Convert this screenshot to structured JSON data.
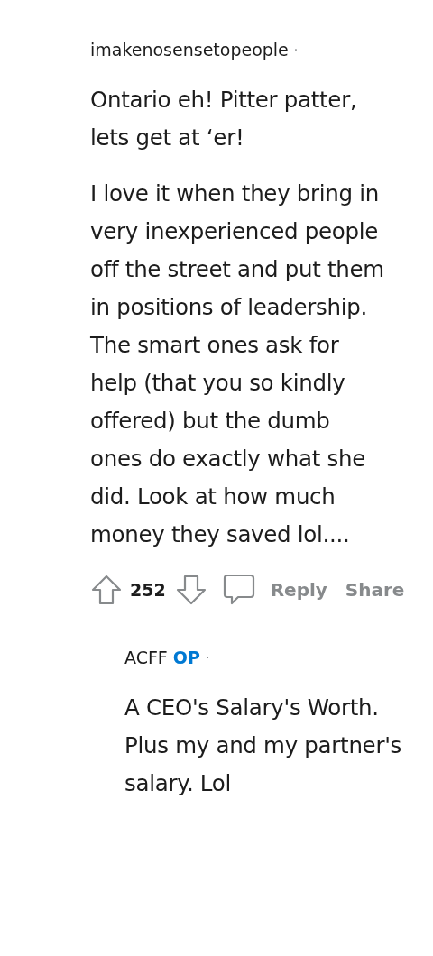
{
  "comments": [
    {
      "author": "imakenosensetopeople",
      "is_op": false,
      "separator": "·",
      "paragraphs": [
        "Ontario eh! Pitter patter, lets get at ‘er!",
        "I love it when they bring in very inexperienced people off the street and put them in positions of leadership. The smart ones ask for help (that you so kindly offered) but the dumb ones do exactly what she did. Look at how much money they saved lol...."
      ],
      "actions": {
        "score": "252",
        "reply": "Reply",
        "share": "Share"
      },
      "replies": [
        {
          "author": "ACFF",
          "is_op": true,
          "badge": "OP",
          "separator": "·",
          "paragraphs": [
            "A CEO's Salary's Worth. Plus my and my partner's salary. Lol"
          ]
        }
      ]
    }
  ]
}
